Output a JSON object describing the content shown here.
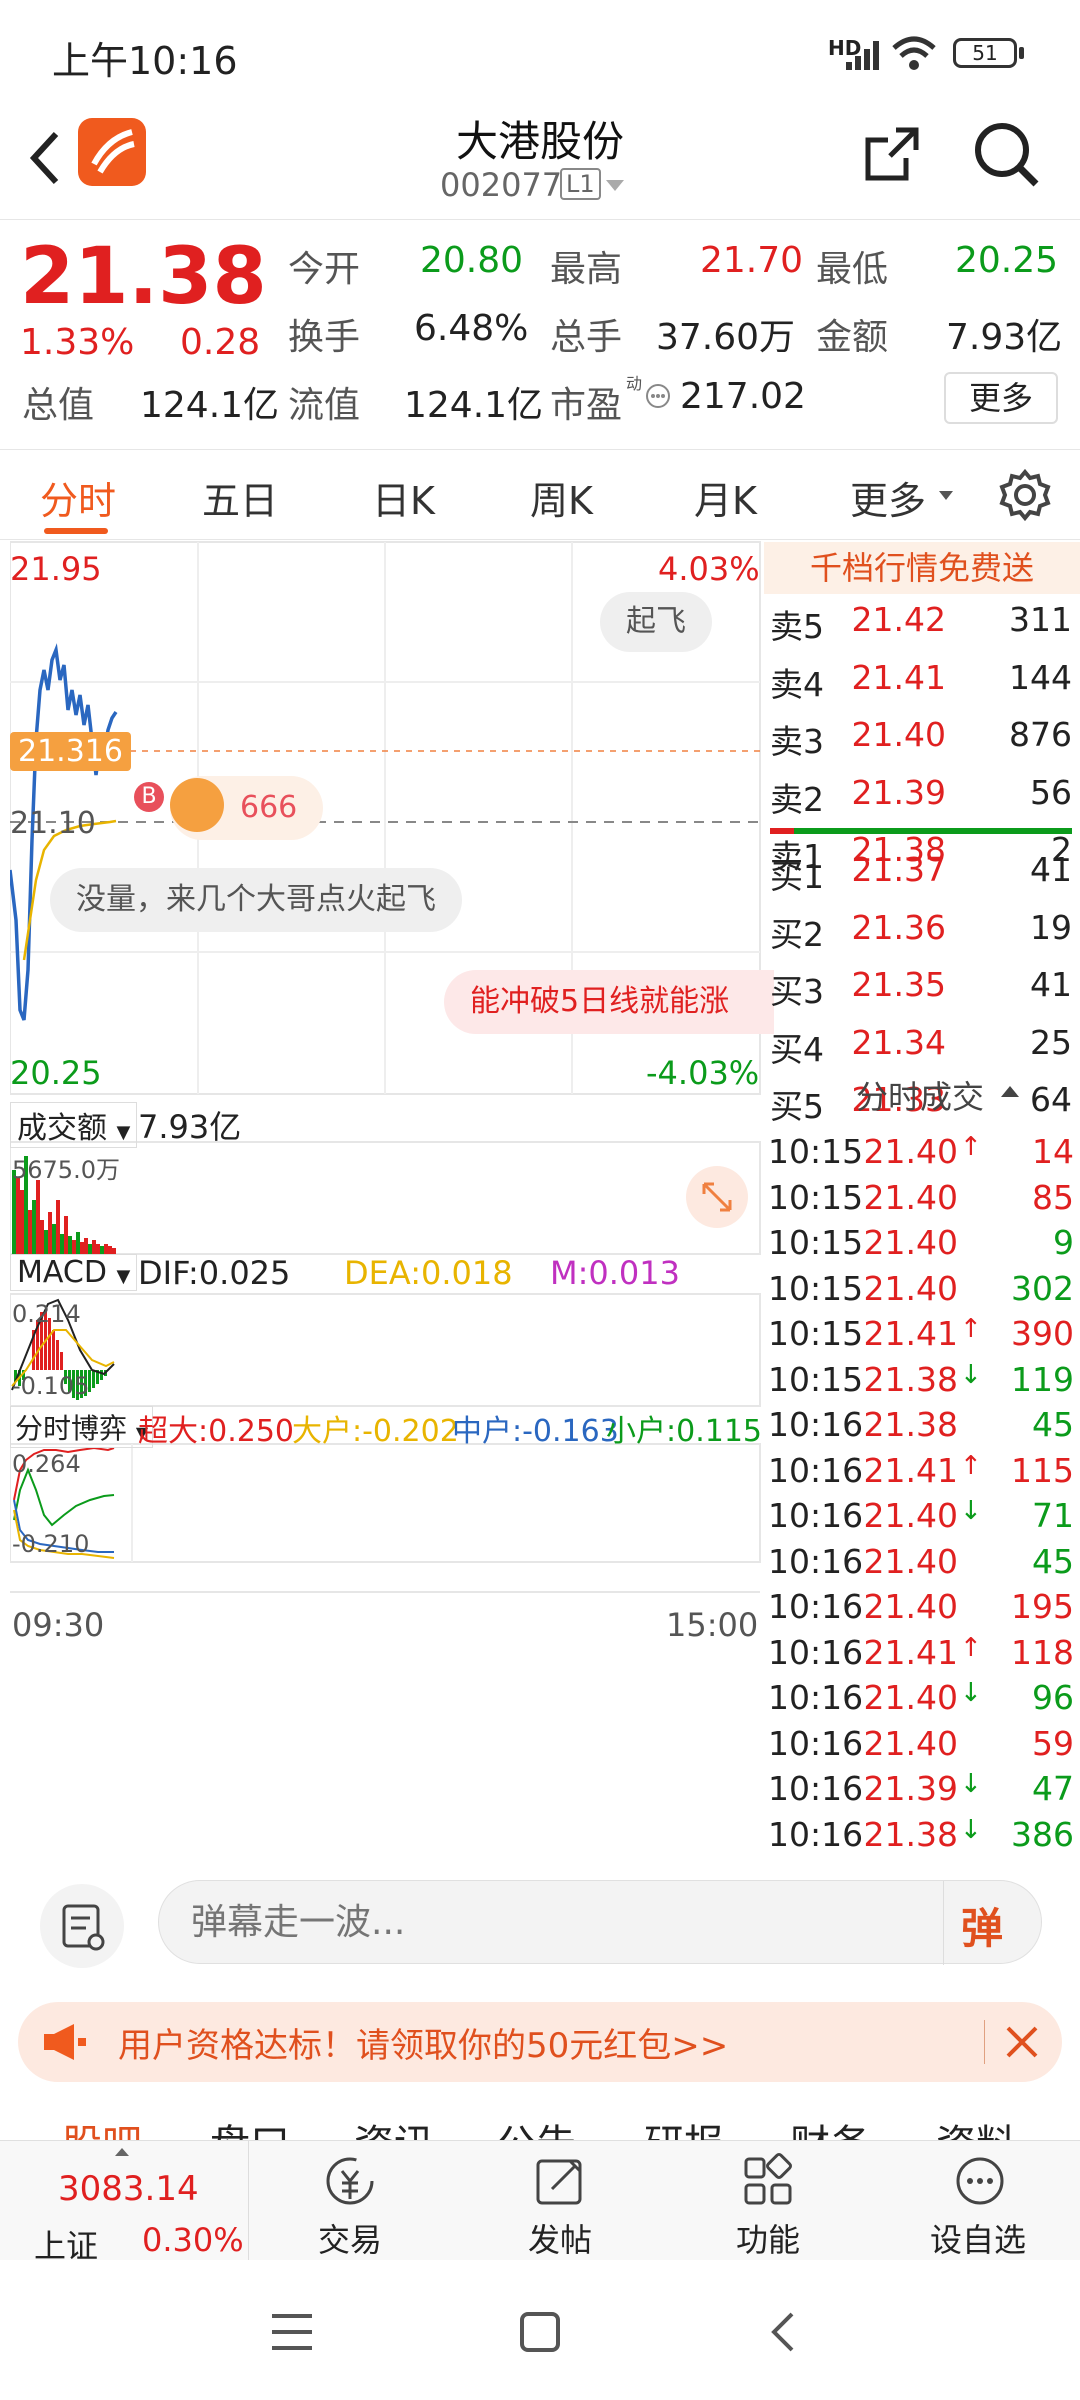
{
  "status": {
    "time": "上午10:16",
    "battery": "51",
    "signal_tag": "HD"
  },
  "header": {
    "title": "大港股份",
    "code": "002077",
    "level": "L1"
  },
  "quote": {
    "price": "21.38",
    "pct": "1.33%",
    "chg": "0.28",
    "open_label": "今开",
    "open": "20.80",
    "high_label": "最高",
    "high": "21.70",
    "low_label": "最低",
    "low": "20.25",
    "turn_label": "换手",
    "turn": "6.48%",
    "vol_label": "总手",
    "vol": "37.60万",
    "amt_label": "金额",
    "amt": "7.93亿",
    "mcap_label": "总值",
    "mcap": "124.1亿",
    "flow_label": "流值",
    "flow": "124.1亿",
    "pe_label": "市盈",
    "pe_sup": "动",
    "pe": "217.02",
    "more": "更多"
  },
  "tabs": [
    "分时",
    "五日",
    "日K",
    "周K",
    "月K",
    "更多"
  ],
  "chart": {
    "ymax": "21.95",
    "ymin": "20.25",
    "pmax": "4.03%",
    "pmin": "-4.03%",
    "ref": "21.10",
    "cur": "21.316",
    "b": "B",
    "danmu1": "起飞",
    "danmu2": "666",
    "danmu3": "没量，来几个大哥点火起飞",
    "danmu4": "能冲破5日线就能涨",
    "vol_sel": "成交额",
    "vol_val": "7.93亿",
    "vol_max": "5675.0万",
    "macd_sel": "MACD",
    "dif": "DIF:0.025",
    "dea": "DEA:0.018",
    "m": "M:0.013",
    "macd_max": "0.214",
    "macd_min": "-0.105",
    "fund_sel": "分时博弈",
    "super": "超大:0.250",
    "big": "大户:-0.202",
    "mid": "中户:-0.163",
    "small": "小户:0.115",
    "fund_max": "0.264",
    "fund_min": "-0.210",
    "t_start": "09:30",
    "t_end": "15:00"
  },
  "book": {
    "promo": "千档行情免费送",
    "sells": [
      {
        "l": "卖5",
        "p": "21.42",
        "v": "311"
      },
      {
        "l": "卖4",
        "p": "21.41",
        "v": "144"
      },
      {
        "l": "卖3",
        "p": "21.40",
        "v": "876"
      },
      {
        "l": "卖2",
        "p": "21.39",
        "v": "56"
      },
      {
        "l": "卖1",
        "p": "21.38",
        "v": "2"
      }
    ],
    "buys": [
      {
        "l": "买1",
        "p": "21.37",
        "v": "41"
      },
      {
        "l": "买2",
        "p": "21.36",
        "v": "19"
      },
      {
        "l": "买3",
        "p": "21.35",
        "v": "41"
      },
      {
        "l": "买4",
        "p": "21.34",
        "v": "25"
      },
      {
        "l": "买5",
        "p": "21.33",
        "v": "64"
      }
    ],
    "ticks_title": "分时成交",
    "ticks": [
      {
        "t": "10:15",
        "p": "21.40",
        "a": "↑",
        "v": "14",
        "vc": "red"
      },
      {
        "t": "10:15",
        "p": "21.40",
        "a": "",
        "v": "85",
        "vc": "red"
      },
      {
        "t": "10:15",
        "p": "21.40",
        "a": "",
        "v": "9",
        "vc": "green"
      },
      {
        "t": "10:15",
        "p": "21.40",
        "a": "",
        "v": "302",
        "vc": "green"
      },
      {
        "t": "10:15",
        "p": "21.41",
        "a": "↑",
        "v": "390",
        "vc": "red"
      },
      {
        "t": "10:15",
        "p": "21.38",
        "a": "↓",
        "v": "119",
        "vc": "green"
      },
      {
        "t": "10:16",
        "p": "21.38",
        "a": "",
        "v": "45",
        "vc": "green"
      },
      {
        "t": "10:16",
        "p": "21.41",
        "a": "↑",
        "v": "115",
        "vc": "red"
      },
      {
        "t": "10:16",
        "p": "21.40",
        "a": "↓",
        "v": "71",
        "vc": "green"
      },
      {
        "t": "10:16",
        "p": "21.40",
        "a": "",
        "v": "45",
        "vc": "green"
      },
      {
        "t": "10:16",
        "p": "21.40",
        "a": "",
        "v": "195",
        "vc": "red"
      },
      {
        "t": "10:16",
        "p": "21.41",
        "a": "↑",
        "v": "118",
        "vc": "red"
      },
      {
        "t": "10:16",
        "p": "21.40",
        "a": "↓",
        "v": "96",
        "vc": "green"
      },
      {
        "t": "10:16",
        "p": "21.40",
        "a": "",
        "v": "59",
        "vc": "red"
      },
      {
        "t": "10:16",
        "p": "21.39",
        "a": "↓",
        "v": "47",
        "vc": "green"
      },
      {
        "t": "10:16",
        "p": "21.38",
        "a": "↓",
        "v": "386",
        "vc": "green"
      }
    ]
  },
  "comment": {
    "placeholder": "弹幕走一波...",
    "send": "弹"
  },
  "banner": {
    "text": "用户资格达标！请领取你的50元红包>>"
  },
  "subtabs": [
    "股吧",
    "盘口",
    "资讯",
    "公告",
    "研报",
    "财务",
    "资料"
  ],
  "bottom": {
    "index": "3083.14",
    "index_name": "上证",
    "index_pct": "0.30%",
    "trade": "交易",
    "post": "发帖",
    "func": "功能",
    "watch": "设自选"
  }
}
